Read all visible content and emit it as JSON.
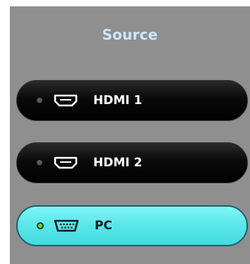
{
  "header": {
    "title": "Source"
  },
  "sources": [
    {
      "label": "HDMI 1",
      "icon": "hdmi-port-icon",
      "selected": false
    },
    {
      "label": "HDMI 2",
      "icon": "hdmi-port-icon",
      "selected": false
    },
    {
      "label": "PC",
      "icon": "vga-port-icon",
      "selected": true
    }
  ],
  "colors": {
    "panel": "#8f8f8f",
    "title": "#c8e8ff",
    "active_button": "#58e6ea",
    "inactive_button": "#000000",
    "active_led": "#79d13c",
    "inactive_led": "#5c5c5c"
  }
}
